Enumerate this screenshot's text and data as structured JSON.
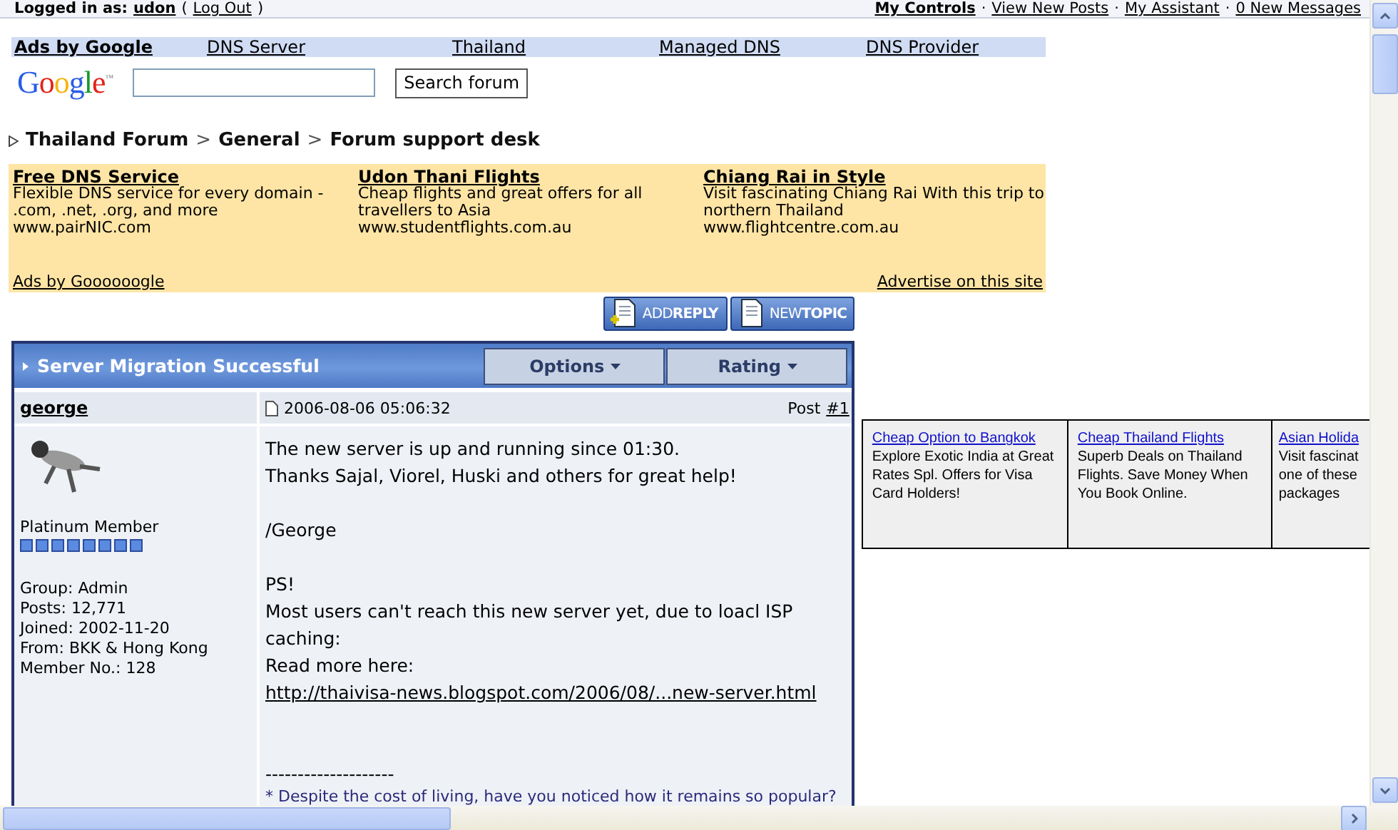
{
  "top_bar": {
    "login_label": "Logged in as:",
    "user": "udon",
    "open": "(",
    "log_out": "Log Out",
    "close": ")",
    "separator": "·",
    "links": [
      {
        "label": "My Controls",
        "bold": true
      },
      {
        "label": "View New Posts",
        "bold": false
      },
      {
        "label": "My Assistant",
        "bold": false
      },
      {
        "label": "0 New Messages",
        "bold": false
      }
    ]
  },
  "ad_links": {
    "title": "Ads by Google",
    "links": [
      "DNS Server",
      "Thailand",
      "Managed DNS",
      "DNS Provider"
    ]
  },
  "search": {
    "logo": "Google",
    "trademark": "™",
    "button": "Search forum"
  },
  "breadcrumb": {
    "separator": ">",
    "items": [
      "Thailand Forum",
      "General",
      "Forum support desk"
    ]
  },
  "ads": {
    "items": [
      {
        "title": "Free DNS Service",
        "text": "Flexible DNS service for every domain - .com, .net, .org, and more",
        "url": "www.pairNIC.com"
      },
      {
        "title": "Udon Thani Flights",
        "text": "Cheap flights and great offers for all travellers to Asia",
        "url": "www.studentflights.com.au"
      },
      {
        "title": "Chiang Rai in Style",
        "text": "Visit fascinating Chiang Rai With this trip to northern Thailand",
        "url": "www.flightcentre.com.au"
      }
    ],
    "footer_left": "Ads by Goooooogle",
    "footer_right": "Advertise on this site"
  },
  "buttons": [
    {
      "kind": "reply",
      "label": "ADD**REPLY**"
    },
    {
      "kind": "topic",
      "label": "NEW**TOPIC**"
    }
  ],
  "topic": {
    "title": "Server Migration Successful",
    "menus": [
      "Options",
      "Rating"
    ]
  },
  "post": {
    "author": "george",
    "date": "2006-08-06 05:06:32",
    "post_label": "Post",
    "post_number": "#1",
    "rank": "Platinum Member",
    "stars": 8,
    "details": [
      "Group: Admin",
      "Posts: 12,771",
      "Joined: 2002-11-20",
      "From: BKK & Hong Kong",
      "Member No.: 128"
    ],
    "body": [
      {
        "kind": "text",
        "text": "The new server is up and running since 01:30."
      },
      {
        "kind": "text",
        "text": "Thanks Sajal, Viorel, Huski and others for great help!"
      },
      {
        "kind": "gap"
      },
      {
        "kind": "text",
        "text": "/George"
      },
      {
        "kind": "gap"
      },
      {
        "kind": "text",
        "text": "PS!"
      },
      {
        "kind": "text",
        "text": "Most users can't reach this new server yet, due to loacl ISP caching:"
      },
      {
        "kind": "text",
        "text": "Read more here:"
      },
      {
        "kind": "link",
        "text": "http://thaivisa-news.blogspot.com/2006/08/...new-server.html"
      }
    ],
    "signature_rule": "--------------------",
    "signature": "* Despite the cost of living, have you noticed how it remains so popular?"
  },
  "side_ads": [
    {
      "title": "Cheap Option to Bangkok",
      "text": "Explore Exotic India at Great Rates Spl. Offers for Visa Card Holders!"
    },
    {
      "title": "Cheap Thailand Flights",
      "text": "Superb Deals on Thailand Flights. Save Money When You Book Online."
    },
    {
      "title": "Asian Holida",
      "text": "Visit fascinat one of these packages"
    }
  ]
}
